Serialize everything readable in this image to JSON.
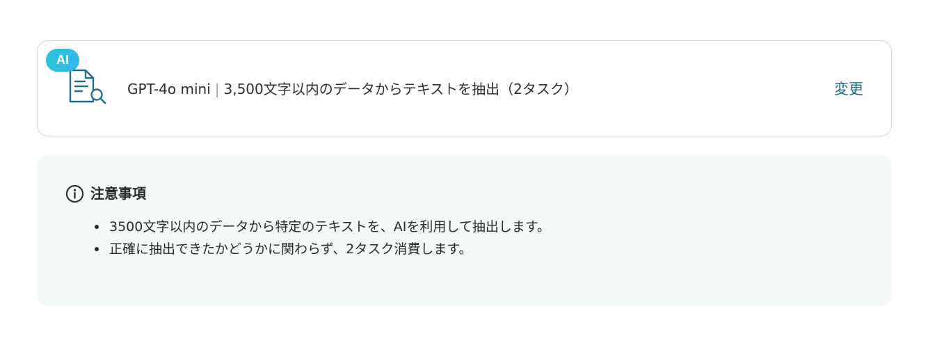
{
  "action_card": {
    "badge": "AI",
    "model": "GPT-4o mini",
    "separator": "|",
    "description": "3,500文字以内のデータからテキストを抽出（2タスク）",
    "change_label": "変更",
    "icon": "document-search-icon",
    "accent_color": "#1f6e8a"
  },
  "notice": {
    "icon": "info-icon",
    "title": "注意事項",
    "items": [
      "3500文字以内のデータから特定のテキストを、AIを利用して抽出します。",
      "正確に抽出できたかどうかに関わらず、2タスク消費します。"
    ],
    "background": "#f3f8f9"
  }
}
